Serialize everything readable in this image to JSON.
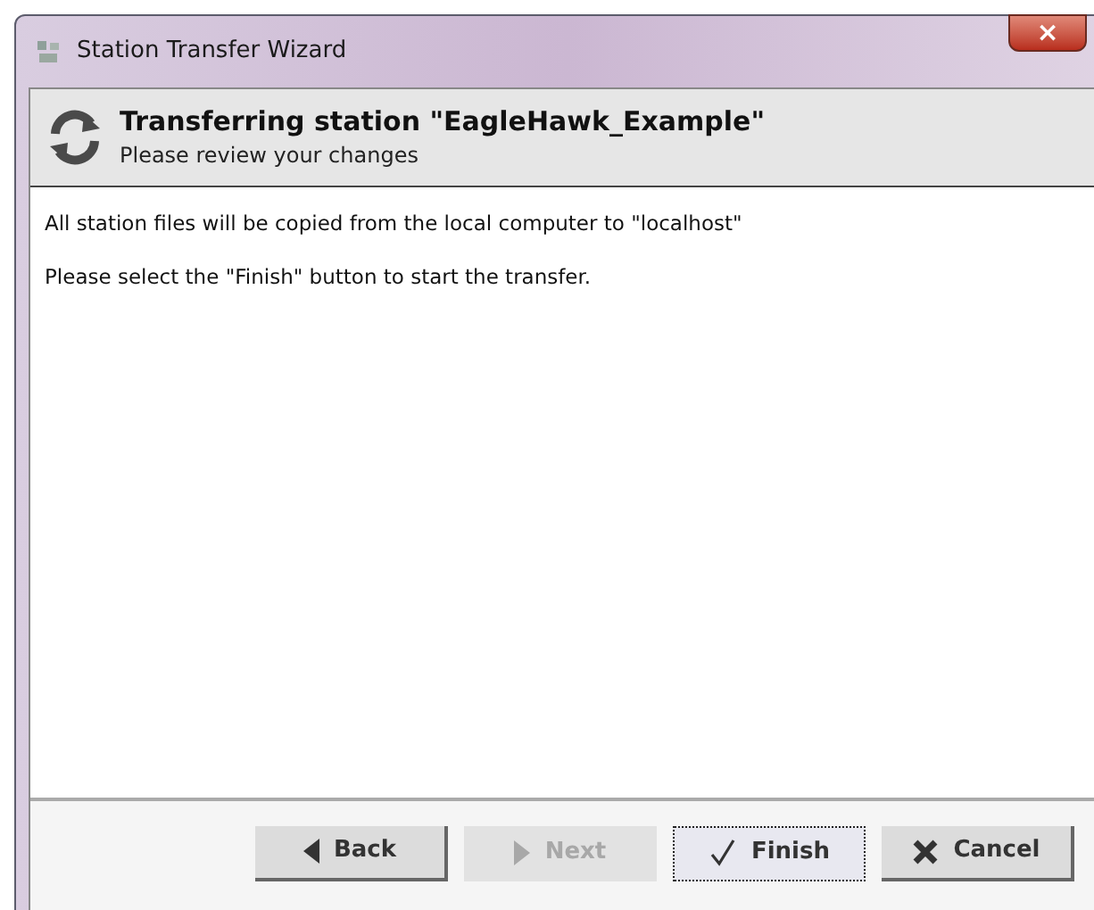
{
  "window": {
    "title": "Station Transfer Wizard",
    "close": "×"
  },
  "header": {
    "title": "Transferring station \"EagleHawk_Example\"",
    "subtitle": "Please review your changes"
  },
  "messages": [
    "All station files will be copied from the local computer to \"localhost\"",
    "Please select the \"Finish\" button to start the transfer."
  ],
  "buttons": [
    {
      "kind": "back",
      "label": "Back",
      "disabled": false,
      "focused": false
    },
    {
      "kind": "next",
      "label": "Next",
      "disabled": true,
      "focused": false
    },
    {
      "kind": "finish",
      "label": "Finish",
      "disabled": false,
      "focused": true
    },
    {
      "kind": "cancel",
      "label": "Cancel",
      "disabled": false,
      "focused": false
    }
  ]
}
